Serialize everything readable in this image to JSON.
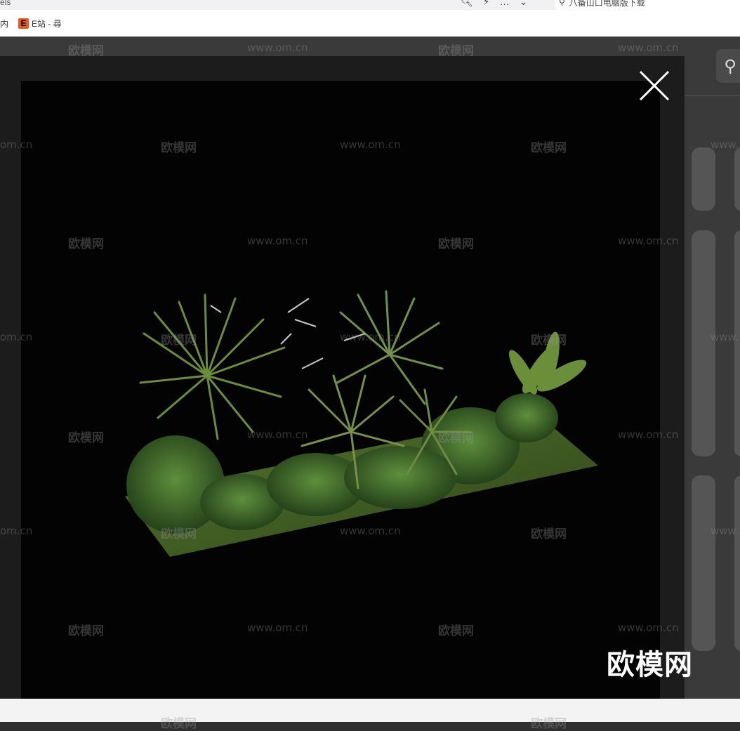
{
  "browser": {
    "url_tail": "els",
    "search_placeholder": "八备山口电脑版下载",
    "bookmarks": [
      {
        "label": "内",
        "icon": ""
      },
      {
        "label": "E站 - 尋",
        "icon": "E"
      }
    ]
  },
  "watermark": {
    "brand": "欧模网",
    "url": "www.om.cn",
    "url_partial": "om.cn",
    "url_partial_left": "www.",
    "logo": "欧模网"
  },
  "modal": {
    "close_icon": "close-icon",
    "image_alt": "plant bed 3d model"
  },
  "colors": {
    "overlay": "#1c1c1c",
    "preview_bg": "#030303",
    "grass": "#4c6a2a",
    "leaf": "#3f6e2c"
  }
}
